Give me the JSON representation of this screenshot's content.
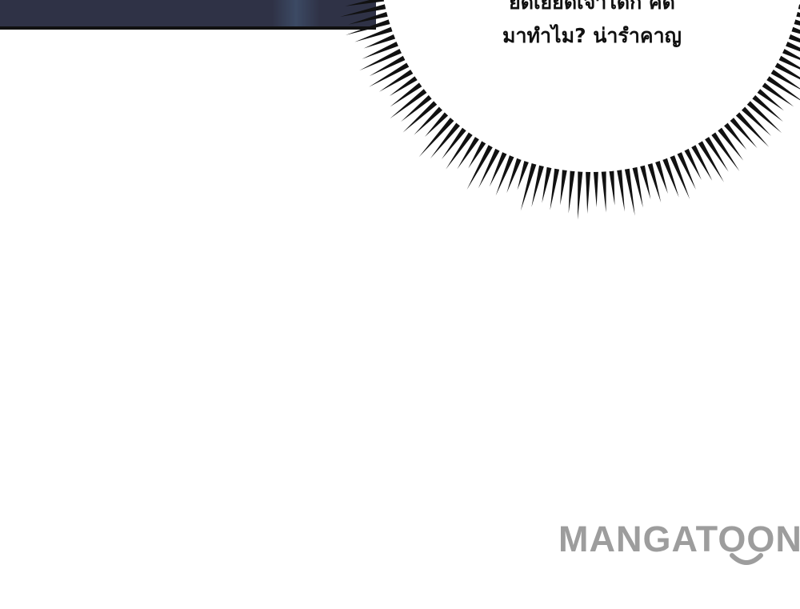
{
  "speech_bubble": {
    "line1": "ยิดเยียดเจ้าได้ก็ คิด",
    "line2": "มาทำไม? น่ารำคาญ"
  },
  "watermark": {
    "text": "MANGATOON"
  },
  "colors": {
    "panel": "#2f3246",
    "burst": "#111111",
    "watermark": "#9d9d9d"
  }
}
